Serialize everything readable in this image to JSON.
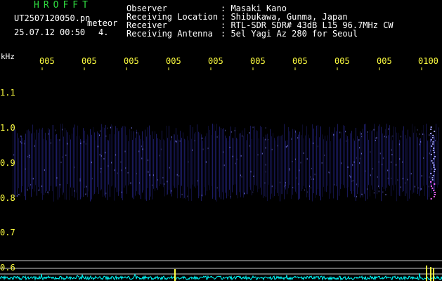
{
  "header": {
    "title": "HROFFT",
    "filename": "UT2507120050.pn",
    "tag": "meteor",
    "datetime": "25.07.12 00:50",
    "version": "4.",
    "fields": [
      {
        "key": "Observer",
        "value": "Masaki Kano"
      },
      {
        "key": "Receiving Location",
        "value": "Shibukawa, Gunma, Japan"
      },
      {
        "key": "Receiver",
        "value": "RTL-SDR SDR# 43dB L15 96.7MHz CW"
      },
      {
        "key": "Receiving Antenna",
        "value": "5el Yagi Az 280 for Seoul"
      }
    ]
  },
  "axis": {
    "unit": "kHz",
    "time_ticks": [
      "005",
      "005",
      "005",
      "005",
      "005",
      "005",
      "005",
      "005",
      "005",
      "0100"
    ],
    "freq_ticks": [
      "1.1",
      "1.0",
      "0.9",
      "0.8",
      "0.7",
      "0.6"
    ]
  },
  "colors": {
    "background": "#000000",
    "signal": "#2a2a9a",
    "bright": "#8080ff",
    "label": "#ffff40",
    "title": "#2fdc40",
    "trace": "#00ffff"
  }
}
